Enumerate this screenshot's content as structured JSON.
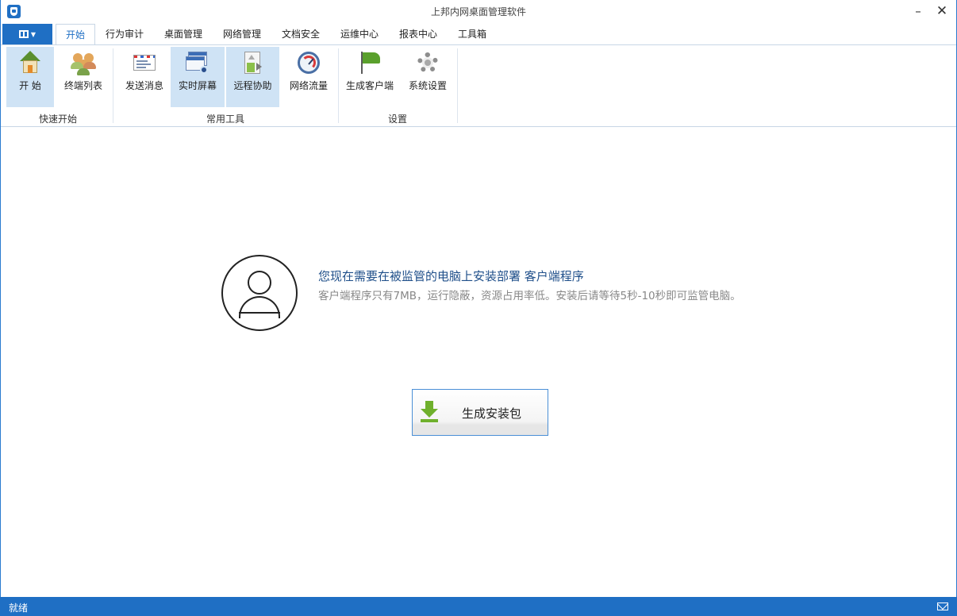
{
  "window": {
    "title": "上邦内网桌面管理软件",
    "minimize_glyph": "–",
    "close_glyph": "✕"
  },
  "menu": {
    "file_icon": "grid-icon",
    "tabs": [
      {
        "label": "开始",
        "active": true
      },
      {
        "label": "行为审计"
      },
      {
        "label": "桌面管理"
      },
      {
        "label": "网络管理"
      },
      {
        "label": "文档安全"
      },
      {
        "label": "运维中心"
      },
      {
        "label": "报表中心"
      },
      {
        "label": "工具箱"
      }
    ]
  },
  "ribbon": {
    "groups": [
      {
        "label": "快速开始",
        "buttons": [
          {
            "label": "开 始",
            "icon": "home-icon",
            "highlighted": true
          },
          {
            "label": "终端列表",
            "icon": "users-icon"
          }
        ]
      },
      {
        "label": "常用工具",
        "buttons": [
          {
            "label": "发送消息",
            "icon": "message-icon"
          },
          {
            "label": "实时屏幕",
            "icon": "screen-icon",
            "highlighted": true
          },
          {
            "label": "远程协助",
            "icon": "remote-icon",
            "highlighted": true
          },
          {
            "label": "网络流量",
            "icon": "gauge-icon"
          }
        ]
      },
      {
        "label": "设置",
        "buttons": [
          {
            "label": "生成客户端",
            "icon": "flag-icon"
          },
          {
            "label": "系统设置",
            "icon": "gear-icon"
          }
        ]
      }
    ]
  },
  "main": {
    "headline": "您现在需要在被监管的电脑上安装部署 客户端程序",
    "description": "客户端程序只有7MB，运行隐蔽，资源占用率低。安装后请等待5秒-10秒即可监管电脑。",
    "generate_button": "生成安装包"
  },
  "status": {
    "text": "就绪"
  },
  "colors": {
    "accent": "#1f6fc4",
    "highlight": "#cfe3f5",
    "headline": "#1f4f8a"
  }
}
